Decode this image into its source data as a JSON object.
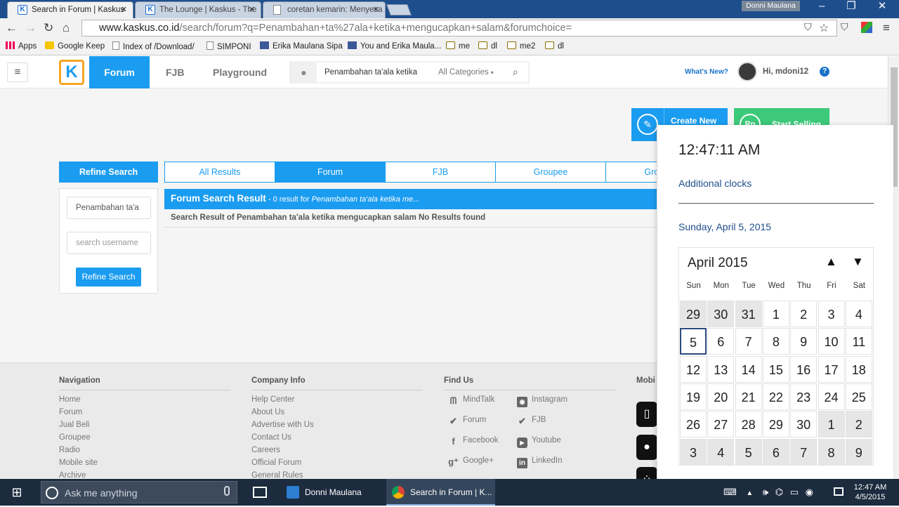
{
  "browser": {
    "tabs": [
      {
        "title": "Search in Forum | Kaskus"
      },
      {
        "title": "The Lounge | Kaskus - The"
      },
      {
        "title": "coretan kemarin: Menyesa"
      }
    ],
    "user": "Donni Maulana",
    "url_host": "www.kaskus.co.id",
    "url_path": "/search/forum?q=Penambahan+ta%27ala+ketika+mengucapkan+salam&forumchoice=",
    "bookmarks": [
      "Apps",
      "Google Keep",
      "Index of /Download/",
      "SIMPONI",
      "Erika Maulana Sipa",
      "You and Erika Maula...",
      "me",
      "dl",
      "me2",
      "dl"
    ]
  },
  "site": {
    "logo": "K",
    "nav": {
      "forum": "Forum",
      "fjb": "FJB",
      "playground": "Playground"
    },
    "search": {
      "query": "Penambahan ta'ala ketika",
      "category": "All Categories"
    },
    "whats_new": "What's New?",
    "greeting": "Hi, mdoni12",
    "help": "?",
    "create_new": "Create New",
    "start_selling": "Start Selling",
    "refine": {
      "title": "Refine Search",
      "query_value": "Penambahan ta'a",
      "username_placeholder": "search username",
      "button": "Refine Search"
    },
    "result_tabs": [
      "All Results",
      "Forum",
      "FJB",
      "Groupee",
      "Group D"
    ],
    "result_title": "Forum Search Result",
    "result_count": " - 0 result for ",
    "result_query": "Penambahan ta'ala ketika me...",
    "result_line": "Search Result of Penambahan ta'ala ketika mengucapkan salam No Results found",
    "footer": {
      "navigation": {
        "title": "Navigation",
        "items": [
          "Home",
          "Forum",
          "Jual Beli",
          "Groupee",
          "Radio",
          "Mobile site",
          "Archive"
        ]
      },
      "company": {
        "title": "Company Info",
        "items": [
          "Help Center",
          "About Us",
          "Advertise with Us",
          "Contact Us",
          "Careers",
          "Official Forum",
          "General Rules"
        ]
      },
      "find_us": {
        "title": "Find Us",
        "left": [
          "MindTalk",
          "Forum",
          "Facebook",
          "Google+"
        ],
        "right": [
          "Instagram",
          "FJB",
          "Youtube",
          "LinkedIn"
        ]
      },
      "mobile": {
        "title": "Mobi"
      }
    }
  },
  "calendar": {
    "time": "12:47:11 AM",
    "additional": "Additional clocks",
    "long_date": "Sunday, April 5, 2015",
    "month": "April 2015",
    "dow": [
      "Sun",
      "Mon",
      "Tue",
      "Wed",
      "Thu",
      "Fri",
      "Sat"
    ],
    "days": [
      "29",
      "30",
      "31",
      "1",
      "2",
      "3",
      "4",
      "5",
      "6",
      "7",
      "8",
      "9",
      "10",
      "11",
      "12",
      "13",
      "14",
      "15",
      "16",
      "17",
      "18",
      "19",
      "20",
      "21",
      "22",
      "23",
      "24",
      "25",
      "26",
      "27",
      "28",
      "29",
      "30",
      "1",
      "2",
      "3",
      "4",
      "5",
      "6",
      "7",
      "8",
      "9"
    ],
    "today": "5"
  },
  "taskbar": {
    "search_placeholder": "Ask me anything",
    "apps": [
      "Donni Maulana",
      "Search in Forum | K..."
    ],
    "time": "12:47 AM",
    "date": "4/5/2015"
  },
  "colors": {
    "kaskus_blue": "#1a9cf0",
    "sell_green": "#3cc97a",
    "taskbar": "#1c2b3e"
  }
}
